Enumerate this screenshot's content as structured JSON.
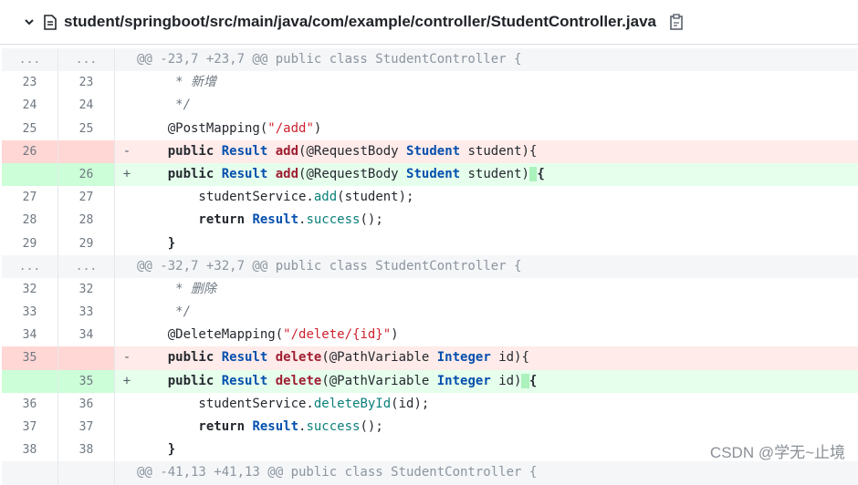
{
  "header": {
    "file_path": "student/springboot/src/main/java/com/example/controller/StudentController.java",
    "icons": {
      "collapse": "chevron-down-icon",
      "file": "file-icon",
      "copy": "clipboard-copy-icon"
    }
  },
  "diff": {
    "hunk1": {
      "old": "...",
      "new": "...",
      "text": "@@ -23,7 +23,7 @@ public class StudentController {"
    },
    "hunk2": {
      "old": "...",
      "new": "...",
      "text": "@@ -32,7 +32,7 @@ public class StudentController {"
    },
    "hunk3": {
      "text": "@@ -41,13 +41,13 @@ public class StudentController {"
    },
    "r1": {
      "old": "23",
      "new": "23",
      "text": "     * 新增"
    },
    "r2": {
      "old": "24",
      "new": "24",
      "text": "     */"
    },
    "r3": {
      "old": "25",
      "new": "25",
      "ann": "    @PostMapping(",
      "str": "\"/add\"",
      "end": ")"
    },
    "r4": {
      "old": "26",
      "sign": "-",
      "kw": "    public ",
      "ty": "Result",
      "fn": "add",
      "p1": "(@RequestBody ",
      "ty2": "Student",
      "p2": " student){"
    },
    "r5": {
      "new": "26",
      "sign": "+",
      "kw": "    public ",
      "ty": "Result",
      "fn": "add",
      "p1": "(@RequestBody ",
      "ty2": "Student",
      "p2": " student)",
      "hl": " ",
      "p3": "{"
    },
    "r6": {
      "old": "27",
      "new": "27",
      "a": "        studentService.",
      "call": "add",
      "b": "(student);"
    },
    "r7": {
      "old": "28",
      "new": "28",
      "kw": "        return ",
      "ty": "Result",
      "dot": ".",
      "call": "success",
      "b": "();"
    },
    "r8": {
      "old": "29",
      "new": "29",
      "text": "    }"
    },
    "r9": {
      "old": "32",
      "new": "32",
      "text": "     * 删除"
    },
    "r10": {
      "old": "33",
      "new": "33",
      "text": "     */"
    },
    "r11": {
      "old": "34",
      "new": "34",
      "ann": "    @DeleteMapping(",
      "str": "\"/delete/{id}\"",
      "end": ")"
    },
    "r12": {
      "old": "35",
      "sign": "-",
      "kw": "    public ",
      "ty": "Result",
      "fn": "delete",
      "p1": "(@PathVariable ",
      "ty2": "Integer",
      "p2": " id){"
    },
    "r13": {
      "new": "35",
      "sign": "+",
      "kw": "    public ",
      "ty": "Result",
      "fn": "delete",
      "p1": "(@PathVariable ",
      "ty2": "Integer",
      "p2": " id)",
      "hl": " ",
      "p3": "{"
    },
    "r14": {
      "old": "36",
      "new": "36",
      "a": "        studentService.",
      "call": "deleteById",
      "b": "(id);"
    },
    "r15": {
      "old": "37",
      "new": "37",
      "kw": "        return ",
      "ty": "Result",
      "dot": ".",
      "call": "success",
      "b": "();"
    },
    "r16": {
      "old": "38",
      "new": "38",
      "text": "    }"
    }
  },
  "watermark": "CSDN @学无~止境",
  "colors": {
    "deleted_bg": "#ffebe9",
    "added_bg": "#e6ffec",
    "hunk_bg": "#f4f6f8"
  }
}
